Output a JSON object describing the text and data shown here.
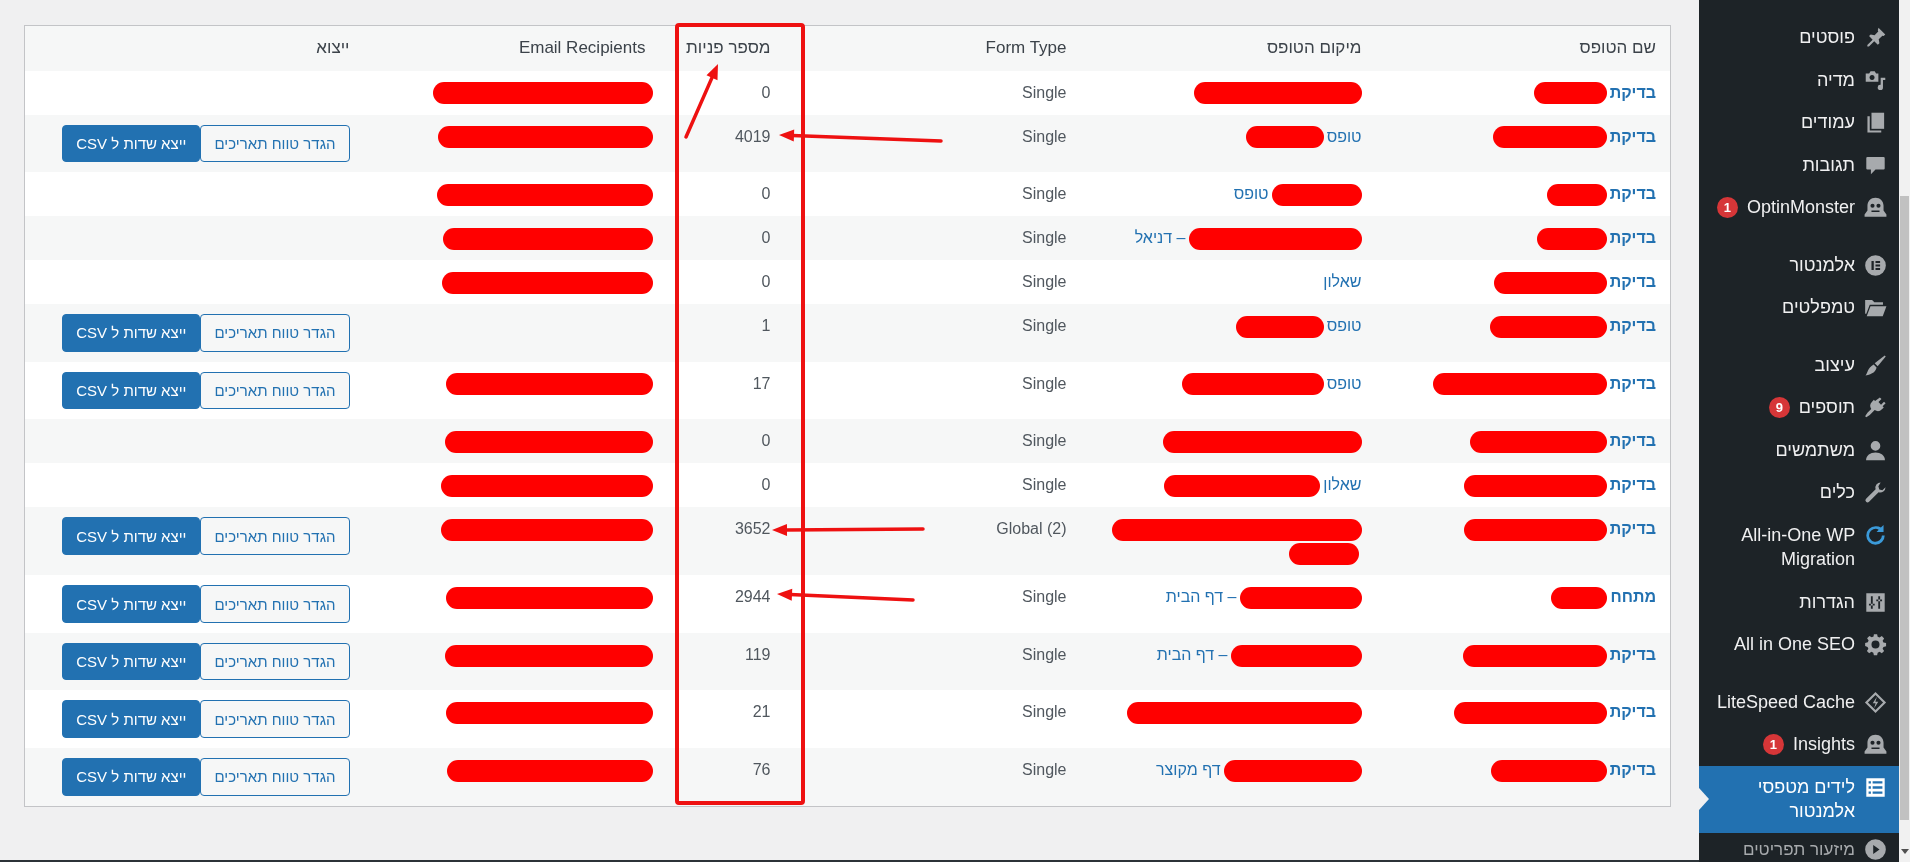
{
  "sidebar": {
    "groups": [
      {
        "items": [
          {
            "label": "פוסטים",
            "selected": false
          },
          {
            "label": "מדיה",
            "selected": false
          },
          {
            "label": "עמודים",
            "selected": false
          },
          {
            "label": "תגובות",
            "selected": false
          },
          {
            "label": "OptinMonster",
            "badge": "1",
            "selected": false
          }
        ]
      },
      {
        "items": [
          {
            "label": "אלמנטור",
            "selected": false
          },
          {
            "label": "טמפלטים",
            "selected": false
          }
        ]
      },
      {
        "items": [
          {
            "label": "עיצוב",
            "selected": false
          },
          {
            "label": "תוספים",
            "badge": "9",
            "selected": false
          },
          {
            "label": "משתמשים",
            "selected": false
          },
          {
            "label": "כלים",
            "selected": false
          },
          {
            "label": "All-in-One WP Migration",
            "selected": false
          },
          {
            "label": "הגדרות",
            "selected": false
          },
          {
            "label": "All in One SEO",
            "selected": false
          }
        ]
      },
      {
        "items": [
          {
            "label": "LiteSpeed Cache",
            "selected": false
          },
          {
            "label": "Insights",
            "badge": "1",
            "selected": false
          },
          {
            "label": "לידים מטפסי אלמנטור",
            "selected": true
          }
        ]
      }
    ],
    "collapse_label": "מיזעור תפריטים"
  },
  "table": {
    "columns": [
      "שם הטופס",
      "מיקום הטופס",
      "Form Type",
      "מספר פניות",
      "Email Recipients",
      "ייצוא"
    ],
    "rows": [
      {
        "name": [
          {
            "kind": "link",
            "text": "בדיקת"
          },
          {
            "kind": "redaction"
          }
        ],
        "location": [
          {
            "kind": "redaction"
          }
        ],
        "form_type": "Single",
        "submissions": "0",
        "email": [
          {
            "kind": "redaction"
          }
        ]
      },
      {
        "name": [
          {
            "kind": "link",
            "text": "בדיקת"
          },
          {
            "kind": "redaction"
          }
        ],
        "location": [
          {
            "kind": "link",
            "text": "טופס"
          },
          {
            "kind": "redaction"
          }
        ],
        "form_type": "Single",
        "submissions": "4019",
        "email": [
          {
            "kind": "redaction"
          }
        ],
        "actions": [
          {
            "label": "הגדר טווח תאריכים",
            "kind": "outline"
          },
          {
            "label": "ייצא שדות ל CSV",
            "kind": "primary"
          }
        ]
      },
      {
        "name": [
          {
            "kind": "link",
            "text": "בדיקת"
          },
          {
            "kind": "redaction"
          }
        ],
        "location": [
          {
            "kind": "redaction"
          },
          {
            "kind": "link",
            "text": "טופס"
          }
        ],
        "form_type": "Single",
        "submissions": "0",
        "email": [
          {
            "kind": "redaction"
          }
        ]
      },
      {
        "name": [
          {
            "kind": "link",
            "text": "בדיקת"
          },
          {
            "kind": "redaction"
          }
        ],
        "location": [
          {
            "kind": "redaction"
          },
          {
            "kind": "link",
            "text": "– דניאל"
          }
        ],
        "form_type": "Single",
        "submissions": "0",
        "email": [
          {
            "kind": "redaction"
          }
        ]
      },
      {
        "name": [
          {
            "kind": "link",
            "text": "בדיקת"
          },
          {
            "kind": "redaction"
          }
        ],
        "location": [
          {
            "kind": "link",
            "text": "שאלון"
          }
        ],
        "form_type": "Single",
        "submissions": "0",
        "email": [
          {
            "kind": "redaction"
          }
        ]
      },
      {
        "name": [
          {
            "kind": "link",
            "text": "בדיקת"
          },
          {
            "kind": "redaction"
          }
        ],
        "location": [
          {
            "kind": "link",
            "text": "טופס"
          },
          {
            "kind": "redaction"
          }
        ],
        "form_type": "Single",
        "submissions": "1",
        "actions": [
          {
            "label": "הגדר טווח תאריכים",
            "kind": "outline"
          },
          {
            "label": "ייצא שדות ל CSV",
            "kind": "primary"
          }
        ]
      },
      {
        "name": [
          {
            "kind": "link",
            "text": "בדיקת"
          },
          {
            "kind": "redaction"
          }
        ],
        "location": [
          {
            "kind": "link",
            "text": "טופס"
          },
          {
            "kind": "redaction"
          }
        ],
        "form_type": "Single",
        "submissions": "17",
        "email": [
          {
            "kind": "redaction"
          }
        ],
        "actions": [
          {
            "label": "הגדר טווח תאריכים",
            "kind": "outline"
          },
          {
            "label": "ייצא שדות ל CSV",
            "kind": "primary"
          }
        ]
      },
      {
        "name": [
          {
            "kind": "link",
            "text": "בדיקת"
          },
          {
            "kind": "redaction"
          }
        ],
        "location": [
          {
            "kind": "redaction"
          }
        ],
        "form_type": "Single",
        "submissions": "0",
        "email": [
          {
            "kind": "redaction"
          }
        ]
      },
      {
        "name": [
          {
            "kind": "link",
            "text": "בדיקת"
          },
          {
            "kind": "redaction"
          }
        ],
        "location": [
          {
            "kind": "link",
            "text": "שאלון"
          },
          {
            "kind": "redaction"
          }
        ],
        "form_type": "Single",
        "submissions": "0",
        "email": [
          {
            "kind": "redaction"
          }
        ]
      },
      {
        "name": [
          {
            "kind": "link",
            "text": "בדיקת"
          },
          {
            "kind": "redaction"
          }
        ],
        "location": [
          {
            "kind": "redaction"
          },
          {
            "kind": "redaction"
          }
        ],
        "form_type": "Global (2)",
        "submissions": "3652",
        "email": [
          {
            "kind": "redaction"
          }
        ],
        "actions": [
          {
            "label": "הגדר טווח תאריכים",
            "kind": "outline"
          },
          {
            "label": "ייצא שדות ל CSV",
            "kind": "primary"
          }
        ]
      },
      {
        "name": [
          {
            "kind": "link",
            "text": "מתחח"
          },
          {
            "kind": "redaction"
          }
        ],
        "location": [
          {
            "kind": "redaction"
          },
          {
            "kind": "link",
            "text": "– דף הבית"
          }
        ],
        "form_type": "Single",
        "submissions": "2944",
        "email": [
          {
            "kind": "redaction"
          }
        ],
        "actions": [
          {
            "label": "הגדר טווח תאריכים",
            "kind": "outline"
          },
          {
            "label": "ייצא שדות ל CSV",
            "kind": "primary"
          }
        ]
      },
      {
        "name": [
          {
            "kind": "link",
            "text": "בדיקת"
          },
          {
            "kind": "redaction"
          }
        ],
        "location": [
          {
            "kind": "redaction"
          },
          {
            "kind": "link",
            "text": "– דף הבית"
          }
        ],
        "form_type": "Single",
        "submissions": "119",
        "email": [
          {
            "kind": "redaction"
          }
        ],
        "actions": [
          {
            "label": "הגדר טווח תאריכים",
            "kind": "outline"
          },
          {
            "label": "ייצא שדות ל CSV",
            "kind": "primary"
          }
        ]
      },
      {
        "name": [
          {
            "kind": "link",
            "text": "בדיקת"
          },
          {
            "kind": "redaction"
          }
        ],
        "location": [
          {
            "kind": "redaction"
          }
        ],
        "form_type": "Single",
        "submissions": "21",
        "email": [
          {
            "kind": "redaction"
          }
        ],
        "actions": [
          {
            "label": "הגדר טווח תאריכים",
            "kind": "outline"
          },
          {
            "label": "ייצא שדות ל CSV",
            "kind": "primary"
          }
        ]
      },
      {
        "name": [
          {
            "kind": "link",
            "text": "בדיקת"
          },
          {
            "kind": "redaction"
          }
        ],
        "location": [
          {
            "kind": "redaction"
          },
          {
            "kind": "link",
            "text": "דף מקוצר"
          }
        ],
        "form_type": "Single",
        "submissions": "76",
        "email": [
          {
            "kind": "redaction"
          }
        ],
        "actions": [
          {
            "label": "הגדר טווח תאריכים",
            "kind": "outline"
          },
          {
            "label": "ייצא שדות ל CSV",
            "kind": "primary"
          }
        ]
      }
    ]
  }
}
